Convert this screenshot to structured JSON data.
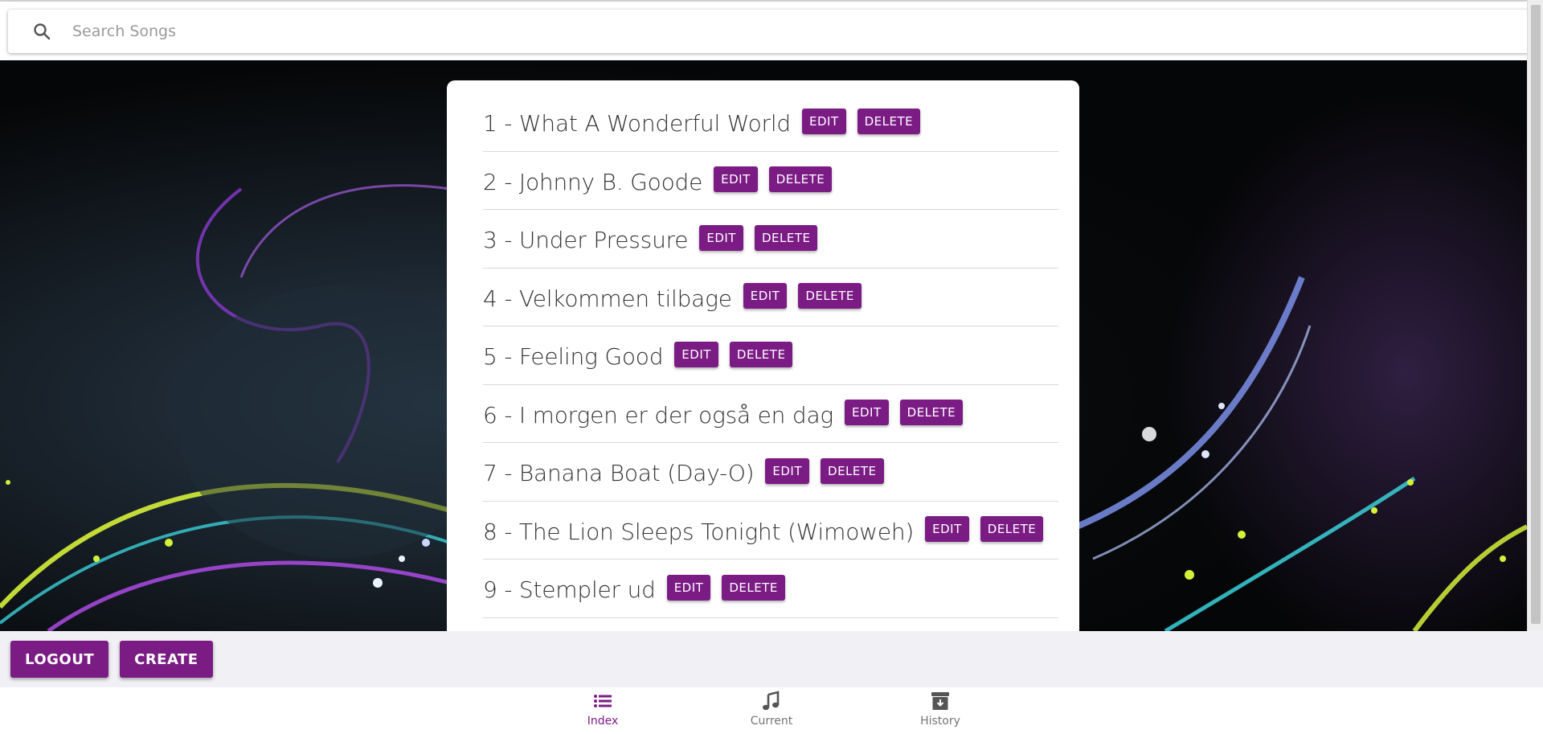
{
  "search": {
    "placeholder": "Search Songs",
    "value": ""
  },
  "songs": [
    {
      "label": "1 - What A Wonderful World"
    },
    {
      "label": "2 - Johnny B. Goode"
    },
    {
      "label": "3 - Under Pressure"
    },
    {
      "label": "4 - Velkommen tilbage"
    },
    {
      "label": "5 - Feeling Good"
    },
    {
      "label": "6 - I morgen er der også en dag"
    },
    {
      "label": "7 - Banana Boat (Day-O)"
    },
    {
      "label": "8 - The Lion Sleeps Tonight (Wimoweh)"
    },
    {
      "label": "9 - Stempler ud"
    }
  ],
  "row_actions": {
    "edit_label": "EDIT",
    "delete_label": "DELETE"
  },
  "actions": {
    "logout_label": "LOGOUT",
    "create_label": "CREATE"
  },
  "nav": {
    "items": [
      {
        "label": "Index",
        "icon": "list-icon",
        "active": true
      },
      {
        "label": "Current",
        "icon": "music-note-icon",
        "active": false
      },
      {
        "label": "History",
        "icon": "archive-icon",
        "active": false
      }
    ]
  },
  "colors": {
    "accent": "#7b1c85",
    "background": "#050607",
    "card": "#ffffff",
    "bar": "#f1f1f5"
  }
}
